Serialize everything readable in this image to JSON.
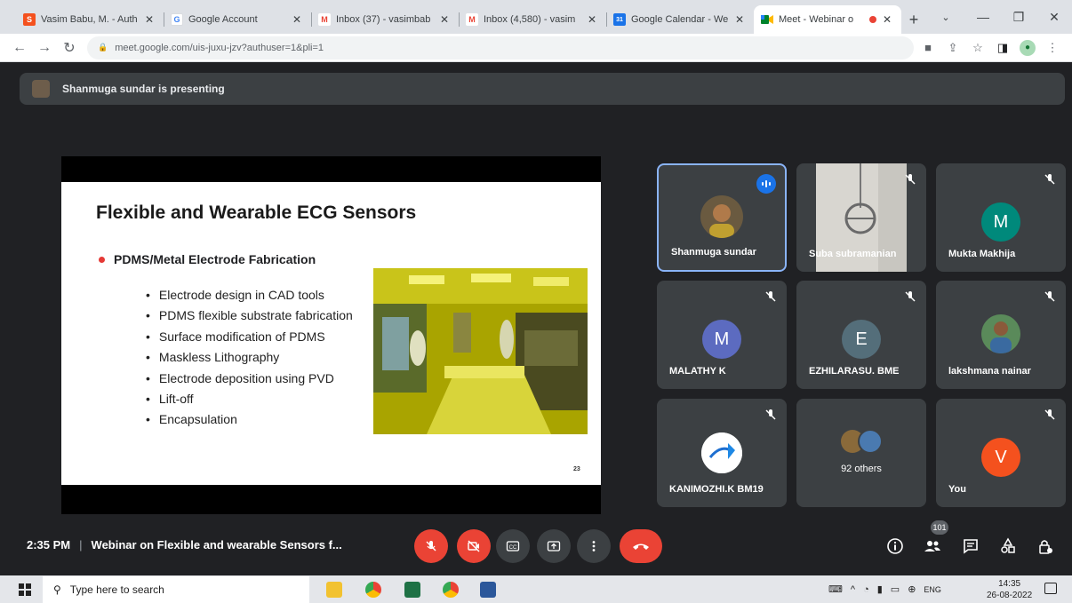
{
  "browser": {
    "tabs": [
      {
        "title": "Vasim Babu, M. - Auth",
        "favicon_color": "#f4511e",
        "favicon_glyph": "S",
        "active": false
      },
      {
        "title": "Google Account",
        "favicon_color": "#4285f4",
        "favicon_glyph": "G",
        "active": false
      },
      {
        "title": "Inbox (37) - vasimbab",
        "favicon_color": "#ea4335",
        "favicon_glyph": "M",
        "active": false
      },
      {
        "title": "Inbox (4,580) - vasim",
        "favicon_color": "#ea4335",
        "favicon_glyph": "M",
        "active": false
      },
      {
        "title": "Google Calendar - We",
        "favicon_color": "#1a73e8",
        "favicon_glyph": "31",
        "active": false
      },
      {
        "title": "Meet - Webinar o",
        "favicon_color": "#00832d",
        "favicon_glyph": "",
        "active": true
      }
    ],
    "url": "meet.google.com/uis-juxu-jzv?authuser=1&pli=1"
  },
  "meet": {
    "presenting_text": "Shanmuga sundar is presenting",
    "time": "2:35 PM",
    "meeting_title": "Webinar on Flexible and wearable Sensors f...",
    "people_count": "101",
    "slide": {
      "title": "Flexible and Wearable ECG Sensors",
      "main_bullet": "PDMS/Metal Electrode Fabrication",
      "sub_bullets": [
        "Electrode design in CAD tools",
        "PDMS flexible substrate fabrication",
        "Surface modification of PDMS",
        "Maskless Lithography",
        "Electrode deposition using PVD",
        "Lift-off",
        "Encapsulation"
      ],
      "page_number": "23"
    },
    "participants": [
      {
        "name": "Shanmuga sundar",
        "avatar": "photo",
        "speaking": true,
        "muted": false
      },
      {
        "name": "Suba subramanian",
        "avatar": "video",
        "speaking": false,
        "muted": true
      },
      {
        "name": "Mukta Makhija",
        "avatar": "M",
        "avatar_color": "#00897b",
        "muted": true
      },
      {
        "name": "MALATHY K",
        "avatar": "M",
        "avatar_color": "#5c6bc0",
        "muted": true
      },
      {
        "name": "EZHILARASU. BME",
        "avatar": "E",
        "avatar_color": "#546e7a",
        "muted": true
      },
      {
        "name": "lakshmana nainar",
        "avatar": "photo",
        "muted": true
      },
      {
        "name": "KANIMOZHI.K BM19",
        "avatar": "photo",
        "muted": true
      },
      {
        "name": "92 others",
        "avatar": "group",
        "muted": false
      },
      {
        "name": "You",
        "avatar": "V",
        "avatar_color": "#f4511e",
        "muted": true
      }
    ]
  },
  "taskbar": {
    "search_placeholder": "Type here to search",
    "language": "ENG",
    "clock_time": "14:35",
    "clock_date": "26-08-2022"
  }
}
